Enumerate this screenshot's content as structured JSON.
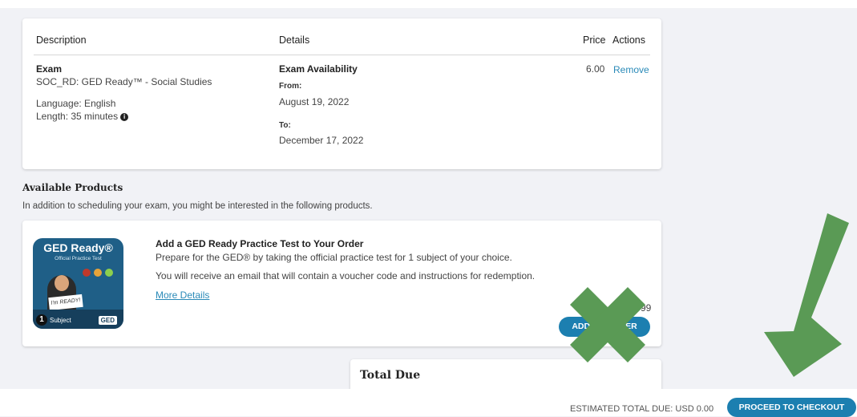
{
  "order_table": {
    "headers": {
      "description": "Description",
      "details": "Details",
      "price": "Price",
      "actions": "Actions"
    },
    "row": {
      "type": "Exam",
      "exam_name": "SOC_RD: GED Ready™ - Social Studies",
      "language": "Language: English",
      "length": "Length: 35 minutes",
      "availability_title": "Exam Availability",
      "from_label": "From:",
      "from_date": "August 19, 2022",
      "to_label": "To:",
      "to_date": "December 17, 2022",
      "price": "6.00",
      "remove_label": "Remove"
    }
  },
  "available_products": {
    "title": "Available Products",
    "description": "In addition to scheduling your exam, you might be interested in the following products.",
    "product": {
      "image_title": "GED Ready®",
      "image_subtitle": "Official Practice Test",
      "image_sign": "I'm READY!",
      "image_number": "1",
      "image_subject": "Subject",
      "image_badge": "GED",
      "title": "Add a GED Ready Practice Test to Your Order",
      "line1": "Prepare for the GED® by taking the official practice test for 1 subject of your choice.",
      "line2": "You will receive an email that will contain a voucher code and instructions for redemption.",
      "more_details": "More Details",
      "price_partial": "99",
      "add_button_left": "ADD",
      "add_button_right": "ER"
    }
  },
  "total": {
    "title": "Total Due"
  },
  "footer": {
    "estimated": "ESTIMATED TOTAL DUE: USD 0.00",
    "checkout": "PROCEED TO CHECKOUT"
  },
  "colors": {
    "accent": "#1c7fb0",
    "link": "#2a8ab8",
    "overlay_green": "#5a9a55",
    "background": "#f1f2f6"
  },
  "icons": {
    "info": "info-circle-icon",
    "annotation_cross": "x-mark-icon",
    "annotation_arrow": "down-left-arrow-icon"
  }
}
